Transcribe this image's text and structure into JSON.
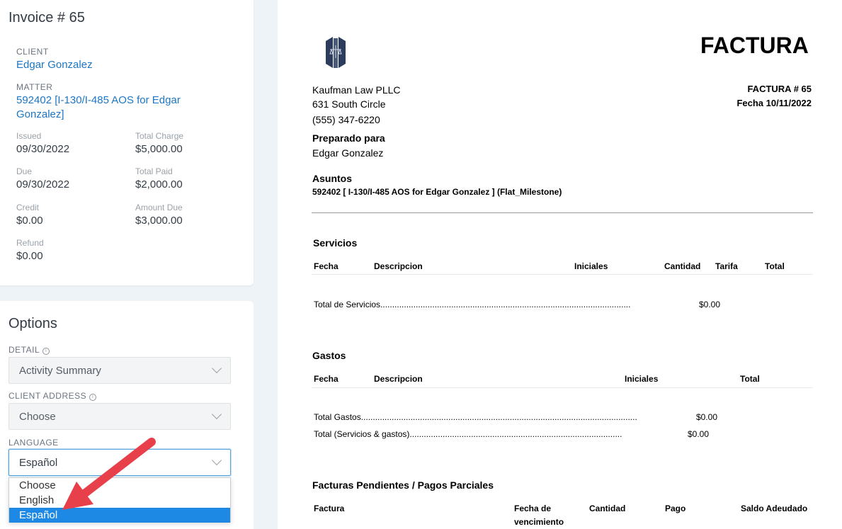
{
  "invoice": {
    "title": "Invoice # 65",
    "client_label": "CLIENT",
    "client_name": "Edgar Gonzalez",
    "matter_label": "MATTER",
    "matter_name": "592402 [I-130/I-485 AOS for Edgar Gonzalez]",
    "fields": {
      "issued_label": "Issued",
      "issued": "09/30/2022",
      "total_charge_label": "Total Charge",
      "total_charge": "$5,000.00",
      "due_label": "Due",
      "due": "09/30/2022",
      "total_paid_label": "Total Paid",
      "total_paid": "$2,000.00",
      "credit_label": "Credit",
      "credit": "$0.00",
      "amount_due_label": "Amount Due",
      "amount_due": "$3,000.00",
      "refund_label": "Refund",
      "refund": "$0.00"
    }
  },
  "options": {
    "title": "Options",
    "detail_label": "DETAIL",
    "detail_value": "Activity Summary",
    "client_address_label": "CLIENT ADDRESS",
    "client_address_value": "Choose",
    "language_label": "LANGUAGE",
    "language_value": "Español",
    "language_options": [
      "Choose",
      "English",
      "Español"
    ],
    "selected_index": 2
  },
  "document": {
    "title": "FACTURA",
    "firm_name": "Kaufman Law PLLC",
    "firm_address": "631 South Circle",
    "firm_phone": "(555) 347-6220",
    "invoice_no": "FACTURA # 65",
    "date": "Fecha 10/11/2022",
    "prepared_for_label": "Preparado para",
    "prepared_for": "Edgar Gonzalez",
    "matters_label": "Asuntos",
    "matter_line": "592402 [ I-130/I-485 AOS for Edgar Gonzalez ] (Flat_Milestone)",
    "services": {
      "title": "Servicios",
      "headers": [
        "Fecha",
        "Descripcion",
        "Iniciales",
        "Cantidad",
        "Tarifa",
        "Total"
      ],
      "total_label": "Total de Servicios..........................................................................................................",
      "total_value": "$0.00"
    },
    "expenses": {
      "title": "Gastos",
      "headers": [
        "Fecha",
        "Descripcion",
        "Iniciales",
        "Total"
      ],
      "total_label": "Total Gastos.....................................................................................................................",
      "total_value": "$0.00",
      "grand_label": "Total (Servicios & gastos)..........................................................................................",
      "grand_value": "$0.00"
    },
    "pending": {
      "title": "Facturas Pendientes / Pagos Parciales",
      "headers": [
        "Factura",
        "Fecha de",
        "vencimiento",
        "Cantidad",
        "Pago",
        "Saldo Adeudado"
      ]
    }
  },
  "colors": {
    "link": "#1c76c5",
    "accent": "#1e88e5",
    "arrow": "#e8404a"
  }
}
